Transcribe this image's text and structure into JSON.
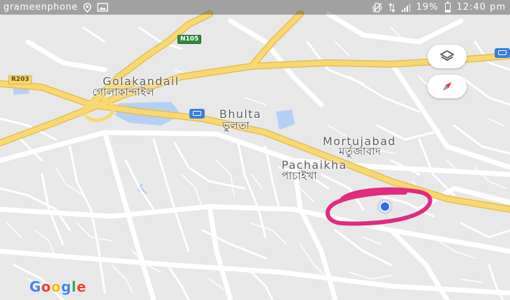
{
  "status_bar": {
    "carrier": "grameenphone",
    "battery_percent": "19%",
    "time": "12:40 pm",
    "icons": [
      "location-icon",
      "image-icon",
      "vibrate-icon",
      "data-arrows-icon",
      "signal-icon",
      "battery-icon"
    ]
  },
  "map": {
    "places": [
      {
        "name": "Golakandail",
        "name_bn": "গোলাকান্দাইল"
      },
      {
        "name": "Bhulta",
        "name_bn": "ভুলতা"
      },
      {
        "name": "Mortujabad",
        "name_bn": "মর্তুজাবাদ"
      },
      {
        "name": "Pachaikha",
        "name_bn": "পাচাইখা"
      }
    ],
    "road_shields": {
      "n105": "N105",
      "r203": "R203"
    },
    "icons": {
      "bus_stops": [
        "bus-icon",
        "bus-icon"
      ],
      "location": "current-location-dot",
      "annotation": "hand-drawn-circle"
    },
    "colors": {
      "background": "#e8e8e8",
      "road_major": "#f6cf65",
      "road_minor": "#ffffff",
      "water": "#a9c8f3",
      "location_dot": "#2d6fe0",
      "annotation": "#e0207a"
    }
  },
  "controls": {
    "layers_icon": "layers-icon",
    "compass_icon": "compass-icon"
  },
  "branding": {
    "logo": "Google",
    "logo_colors": [
      "#4285F4",
      "#EA4335",
      "#FBBC05",
      "#4285F4",
      "#34A853",
      "#EA4335"
    ]
  }
}
